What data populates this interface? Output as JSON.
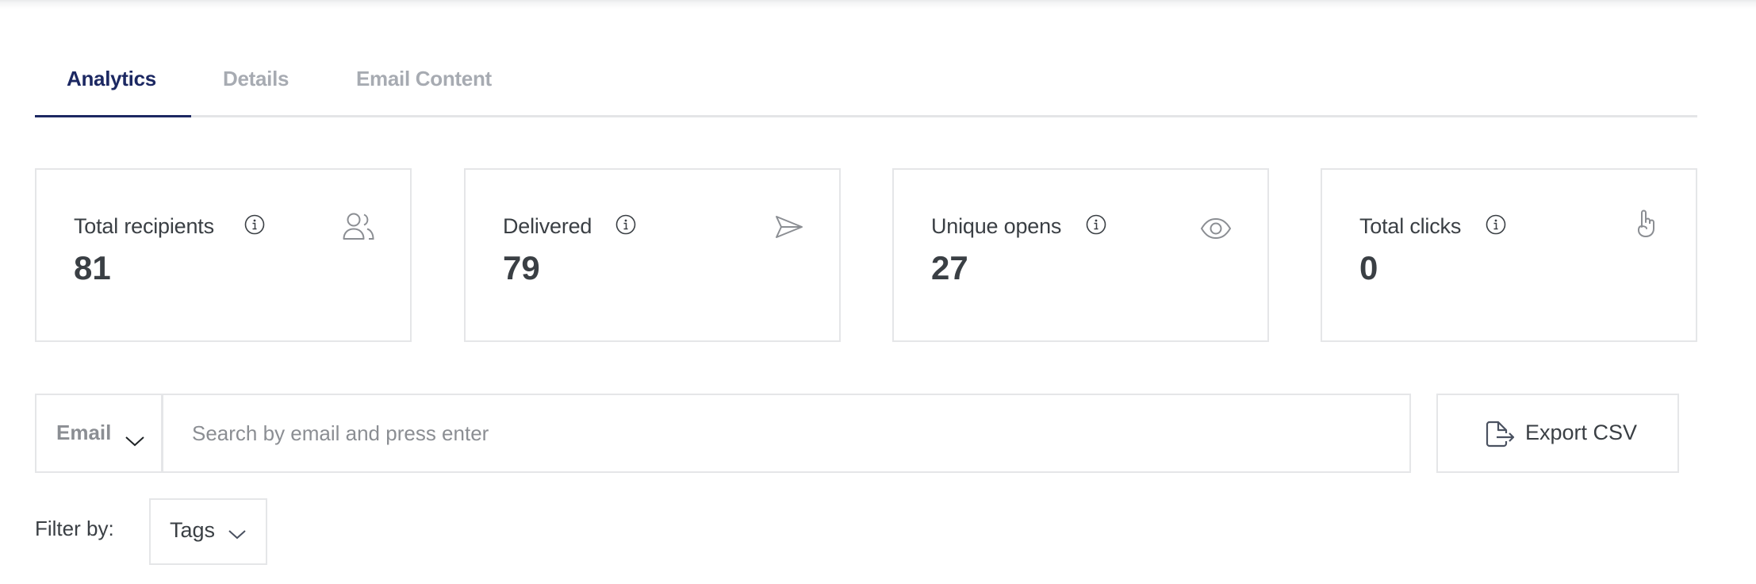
{
  "tabs": [
    {
      "label": "Analytics",
      "active": true
    },
    {
      "label": "Details",
      "active": false
    },
    {
      "label": "Email Content",
      "active": false
    }
  ],
  "stats": [
    {
      "label": "Total recipients",
      "value": "81",
      "icon": "users-icon"
    },
    {
      "label": "Delivered",
      "value": "79",
      "icon": "send-icon"
    },
    {
      "label": "Unique opens",
      "value": "27",
      "icon": "eye-icon"
    },
    {
      "label": "Total clicks",
      "value": "0",
      "icon": "pointer-hand-icon"
    }
  ],
  "search": {
    "field_select": "Email",
    "placeholder": "Search by email and press enter",
    "value": ""
  },
  "export": {
    "label": "Export CSV",
    "icon": "file-export-icon"
  },
  "filter": {
    "label": "Filter by:",
    "tags_select": "Tags"
  },
  "colors": {
    "accent": "#1c2862",
    "inactive_tab": "#a7abb2",
    "border": "#e5e6e8",
    "text": "#3a3f44",
    "muted": "#8b8e93"
  }
}
